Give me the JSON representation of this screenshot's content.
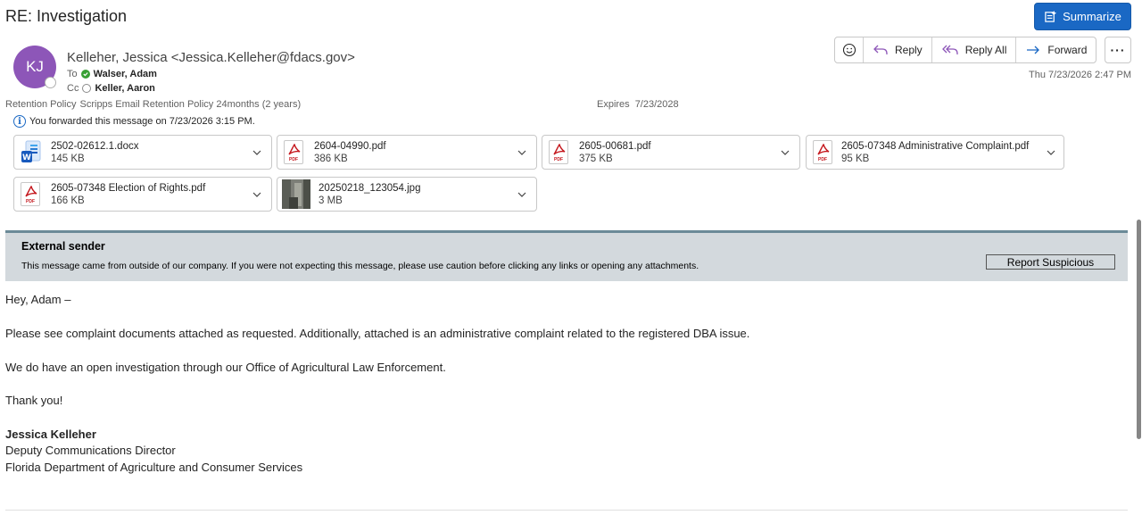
{
  "message": {
    "subject": "RE: Investigation",
    "summarize_label": "Summarize",
    "avatar_initials": "KJ",
    "sender": "Kelleher, Jessica <Jessica.Kelleher@fdacs.gov>",
    "to_label": "To",
    "to_name": "Walser, Adam",
    "cc_label": "Cc",
    "cc_name": "Keller, Aaron",
    "retention_label": "Retention Policy",
    "retention_value": "Scripps Email Retention Policy 24months (2 years)",
    "expires_label": "Expires",
    "expires_value": "7/23/2028",
    "forwarded_note": "You forwarded this message on 7/23/2026 3:15 PM.",
    "datetime": "Thu 7/23/2026 2:47 PM"
  },
  "actions": {
    "reply": "Reply",
    "reply_all": "Reply All",
    "forward": "Forward"
  },
  "attachments": [
    {
      "name": "2502-02612.1.docx",
      "size": "145 KB",
      "type": "word"
    },
    {
      "name": "2604-04990.pdf",
      "size": "386 KB",
      "type": "pdf"
    },
    {
      "name": "2605-00681.pdf",
      "size": "375 KB",
      "type": "pdf"
    },
    {
      "name": "2605-07348 Administrative Complaint.pdf",
      "size": "95 KB",
      "type": "pdf"
    },
    {
      "name": "2605-07348 Election of Rights.pdf",
      "size": "166 KB",
      "type": "pdf"
    },
    {
      "name": "20250218_123054.jpg",
      "size": "3 MB",
      "type": "image"
    }
  ],
  "external_banner": {
    "title": "External sender",
    "message": "This message came from outside of our company. If you were not expecting this message, please use caution before clicking any links or opening any attachments.",
    "report_label": "Report Suspicious"
  },
  "body": {
    "greeting": "Hey, Adam –",
    "p1": "Please see complaint documents attached as requested. Additionally, attached is an administrative complaint related to the registered DBA issue.",
    "p2": "We do have an open investigation through our Office of Agricultural Law Enforcement.",
    "thanks": "Thank you!",
    "sig_name": "Jessica Kelleher",
    "sig_title": "Deputy Communications Director",
    "sig_org": "Florida Department of Agriculture and Consumer Services"
  },
  "colors": {
    "accent": "#1a68c4",
    "avatar": "#8d56b8",
    "pdf_red": "#c4161c",
    "banner_bg": "#d3d9dd"
  }
}
